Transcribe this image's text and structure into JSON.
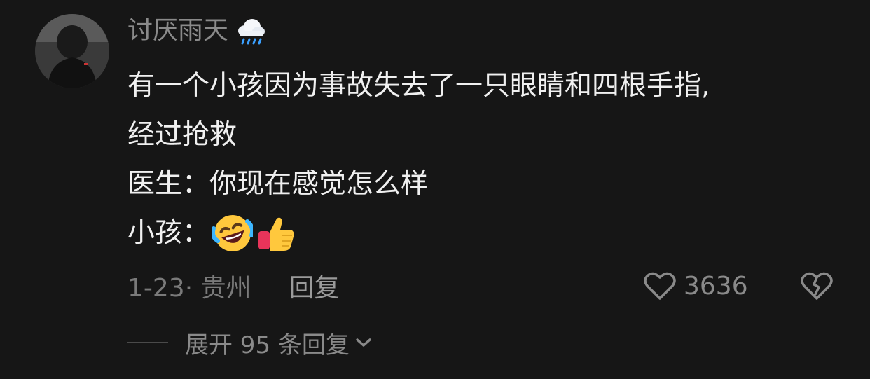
{
  "comment": {
    "username": "讨厌雨天",
    "username_icon": "cloud-rain-icon",
    "text_lines": [
      "有一个小孩因为事故失去了一只眼睛和四根手指,",
      "经过抢救",
      "医生：你现在感觉怎么样",
      "小孩："
    ],
    "emojis": [
      "rolling-on-floor-laughing-emoji",
      "thumbs-up-emoji"
    ],
    "date_location": "1-23· 贵州",
    "reply_label": "回复",
    "like_count": "3636",
    "expand_label": "展开 95 条回复"
  },
  "colors": {
    "background": "#161616",
    "text_primary": "#f0f0f0",
    "text_secondary": "#8a8a8a"
  }
}
